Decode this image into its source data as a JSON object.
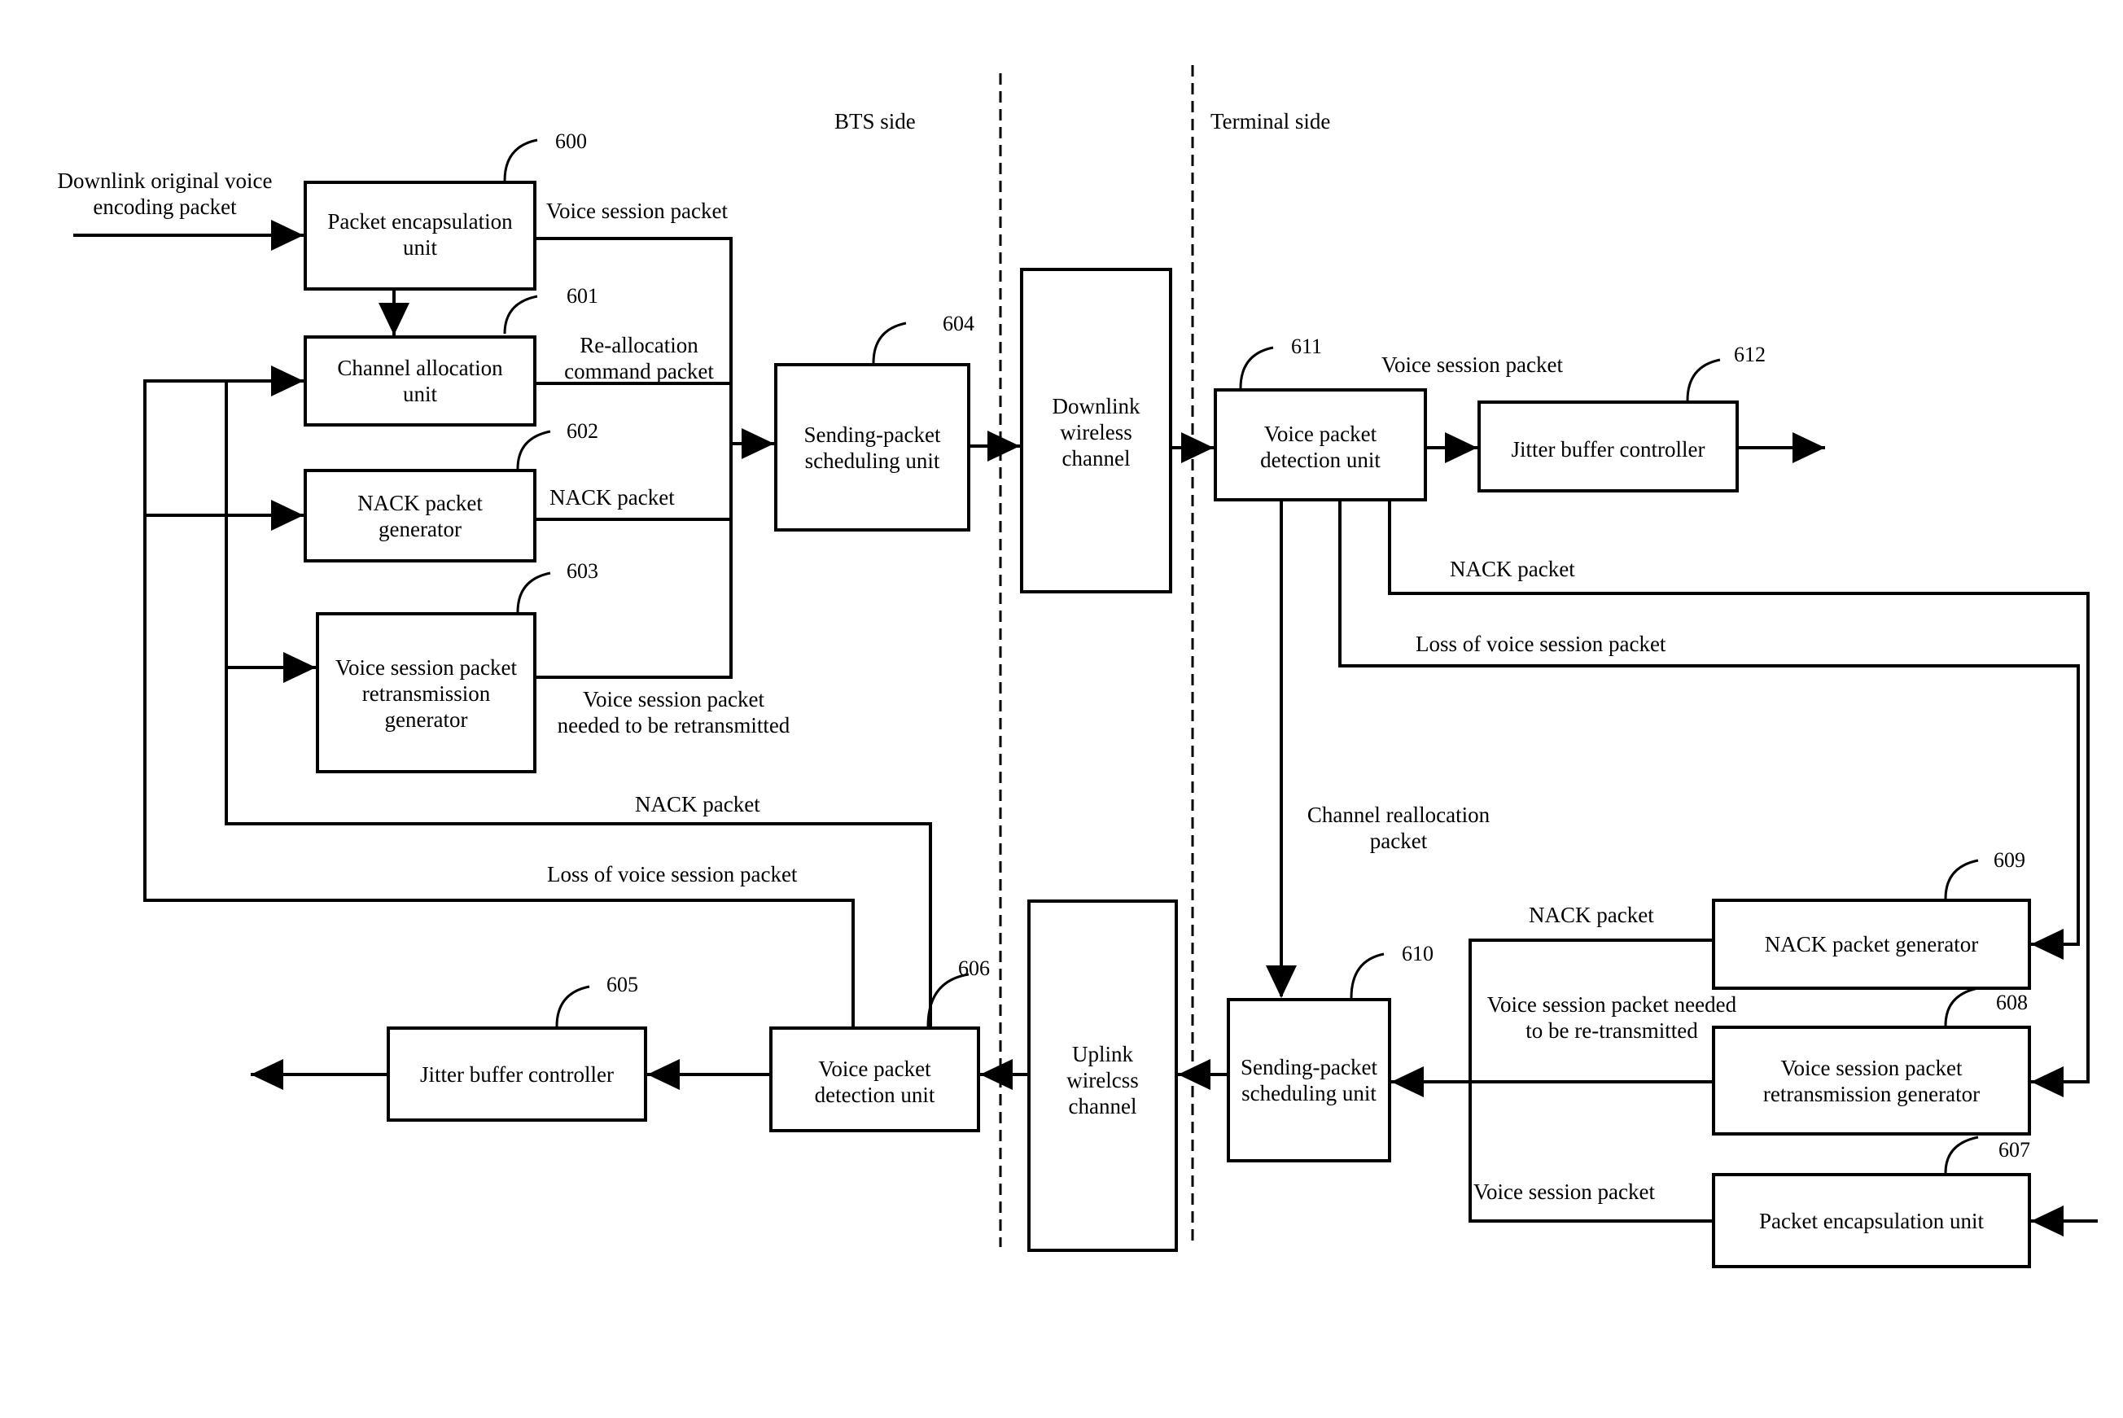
{
  "figure": {
    "sides": {
      "bts": "BTS side",
      "terminal": "Terminal side"
    },
    "input_label": "Downlink original voice\nencoding packet",
    "boxes": {
      "b600": {
        "ref": "600",
        "text": "Packet encapsulation\nunit"
      },
      "b601": {
        "ref": "601",
        "text": "Channel allocation\nunit"
      },
      "b602": {
        "ref": "602",
        "text": "NACK packet\ngenerator"
      },
      "b603": {
        "ref": "603",
        "text": "Voice session packet\nretransmission\ngenerator"
      },
      "b604": {
        "ref": "604",
        "text": "Sending-packet\nscheduling unit"
      },
      "b605": {
        "ref": "605",
        "text": "Jitter buffer controller"
      },
      "b606": {
        "ref": "606",
        "text": "Voice packet\ndetection unit"
      },
      "b607": {
        "ref": "607",
        "text": "Packet encapsulation unit"
      },
      "b608": {
        "ref": "608",
        "text": "Voice session packet\nretransmission generator"
      },
      "b609": {
        "ref": "609",
        "text": "NACK packet generator"
      },
      "b610": {
        "ref": "610",
        "text": "Sending-packet\nscheduling unit"
      },
      "b611": {
        "ref": "611",
        "text": "Voice packet\ndetection unit"
      },
      "b612": {
        "ref": "612",
        "text": "Jitter buffer controller"
      },
      "downlink": {
        "text": "Downlink\nwireless\nchannel"
      },
      "uplink": {
        "text": "Uplink\nwirelcss\nchannel"
      }
    },
    "edge_labels": {
      "bts_voice_session": "Voice session packet",
      "bts_realloc": "Re-allocation\ncommand packet",
      "bts_nack": "NACK packet",
      "bts_retx": "Voice session packet\nneeded to be retransmitted",
      "bts_fb_nack": "NACK packet",
      "bts_fb_loss": "Loss of voice session packet",
      "term_voice_session": "Voice session packet",
      "term_nack": "NACK packet",
      "term_loss": "Loss of voice session packet",
      "term_realloc": "Channel reallocation\npacket",
      "term_up_nack": "NACK packet",
      "term_up_retx": "Voice session packet needed\nto be re-transmitted",
      "term_up_voice": "Voice session packet"
    }
  }
}
